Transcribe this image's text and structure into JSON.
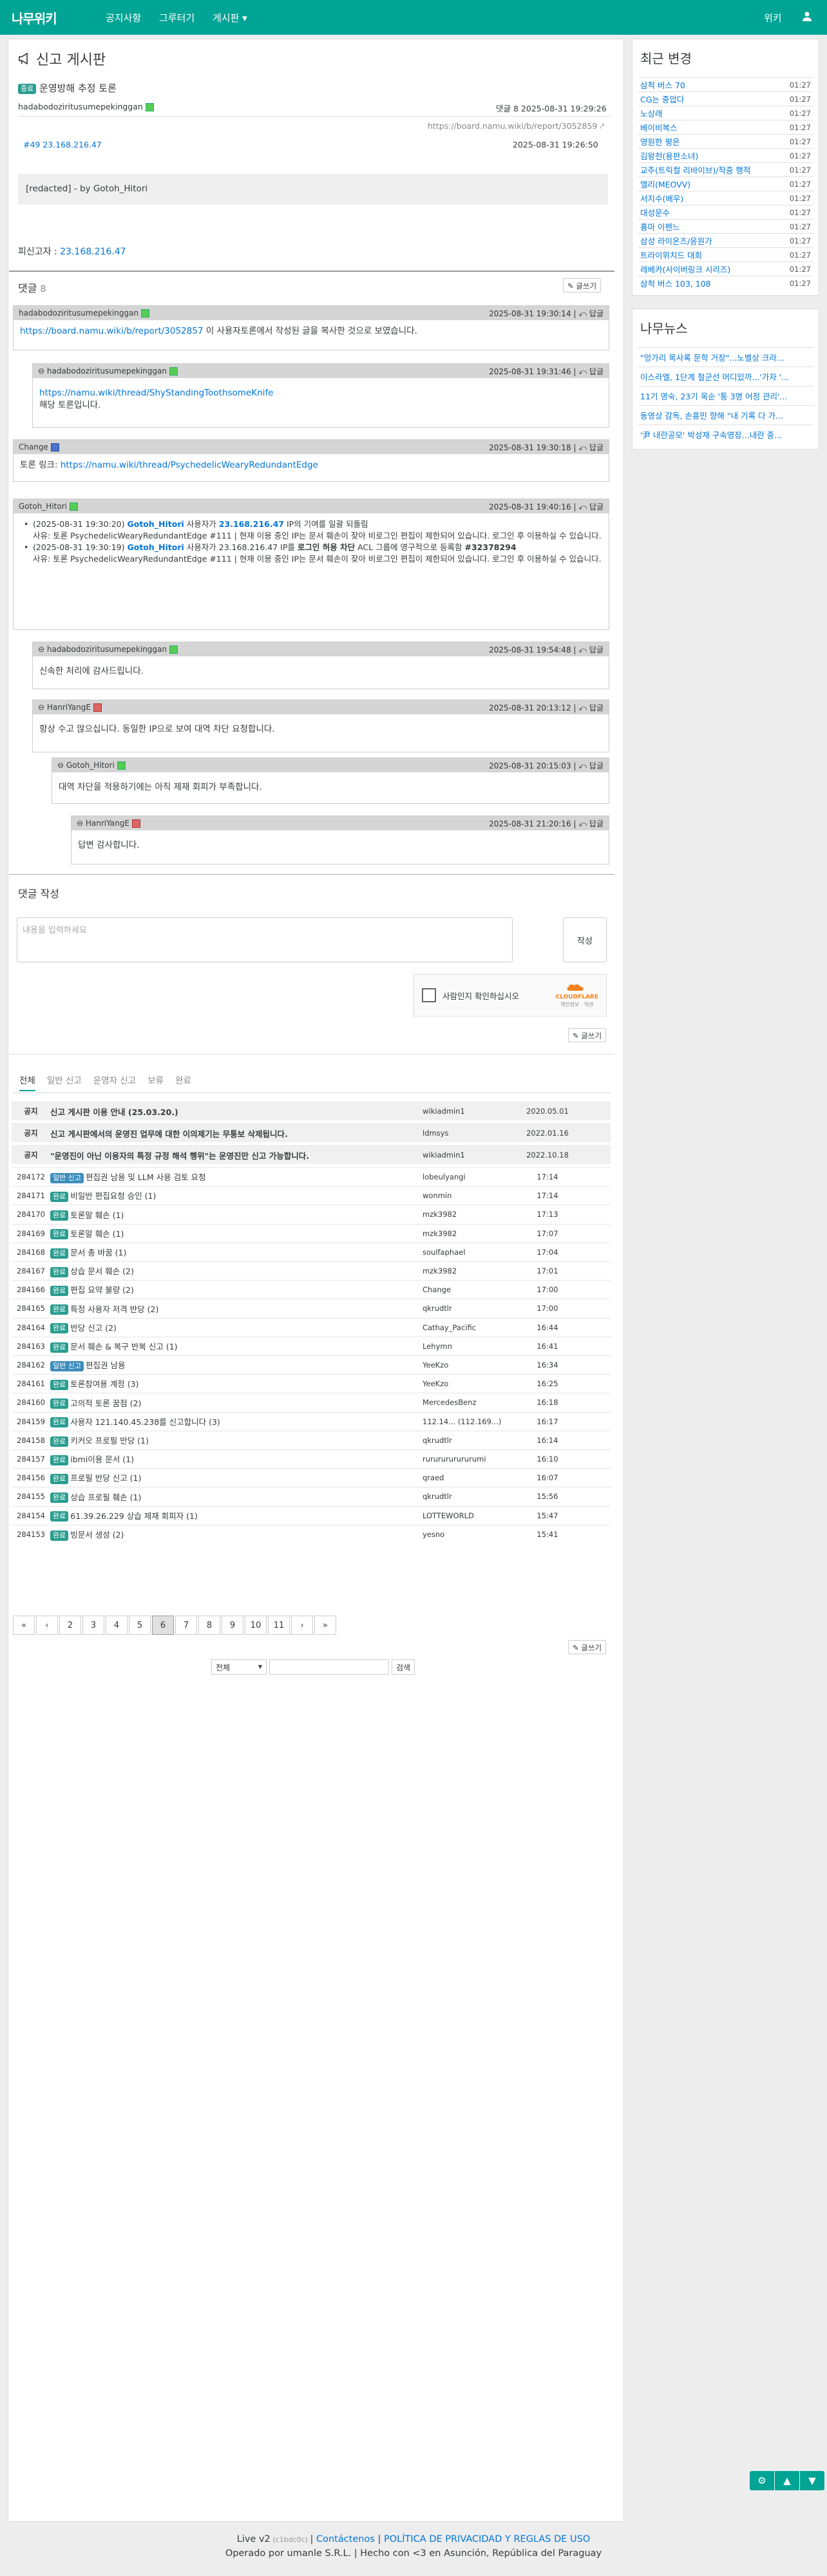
{
  "nav": {
    "logo": "나무위키",
    "items": [
      "공지사항",
      "그루터기",
      "게시판 ▾"
    ],
    "wiki": "위키",
    "user_icon": "user-icon"
  },
  "post": {
    "title": "신고 게시판",
    "badge": "종료",
    "subject": "운영방해 추정 토론",
    "author": "hadabodoziritusumepekinggan",
    "reply_label": "댓글",
    "datetime": "8 2025-08-31 19:29:26",
    "url": "https://board.namu.wiki/b/report/3052859",
    "ref": "#49 23.168.216.47",
    "ref_time": "2025-08-31 19:26:50",
    "quote": "[redacted] - by Gotoh_Hitori",
    "last_editor_label": "피신고자 :",
    "last_editor": "23.168.216.47"
  },
  "comments": {
    "title": "댓글",
    "count": "8",
    "write_label": "글쓰기",
    "reply": "답글",
    "items": [
      {
        "author": "hadabodoziritusumepekinggan",
        "time": "2025-08-31 19:30:14",
        "link": "https://board.namu.wiki/b/report/3052857",
        "text": " 이 사용자토론에서 작성된 글을 복사한 것으로 보였습니다."
      },
      {
        "author": "hadabodoziritusumepekinggan",
        "time": "2025-08-31 19:31:46",
        "link": "https://namu.wiki/thread/ShyStandingToothsomeKnife",
        "text": "해당 토론입니다."
      },
      {
        "author": "Change",
        "time": "2025-08-31 19:30:18",
        "label": "토론 링크: ",
        "link": "https://namu.wiki/thread/PsychedelicWearyRedundantEdge"
      },
      {
        "author": "Gotoh_Hitori",
        "time": "2025-08-31 19:40:16",
        "l1a": "(2025-08-31 19:30:20) ",
        "l1b": "Gotoh_Hitori",
        "l1c": " 사용자가 ",
        "l1d": "23.168.216.47",
        "l1e": " IP의 기여를 일괄 되돌림",
        "l1f": "사유: 토론 PsychedelicWearyRedundantEdge #111 | 현재 이용 중인 IP는 문서 훼손이 잦아 비로그인 편집이 제한되어 있습니다. 로그인 후 이용하실 수 있습니다.",
        "l2a": "(2025-08-31 19:30:19) ",
        "l2b": "Gotoh_Hitori",
        "l2c": " 사용자가 23.168.216.47 IP를 ",
        "l2d": "로그인 허용 차단",
        "l2e": " ACL 그룹에 영구적으로 등록함 ",
        "l2f": "#32378294",
        "l2g": "사유: 토론 PsychedelicWearyRedundantEdge #111 | 현재 이용 중인 IP는 문서 훼손이 잦아 비로그인 편집이 제한되어 있습니다. 로그인 후 이용하실 수 있습니다."
      },
      {
        "author": "hadabodoziritusumepekinggan",
        "time": "2025-08-31 19:54:48",
        "text": "신속한 처리에 감사드립니다."
      },
      {
        "author": "HanriYangE",
        "time": "2025-08-31 20:13:12",
        "text": "항상 수고 많으십니다. 동일한 IP으로 보여 대역 차단 요청합니다."
      },
      {
        "author": "Gotoh_Hitori",
        "time": "2025-08-31 20:15:03",
        "text": "대역 차단을 적용하기에는 아직 제재 회피가 부족합니다."
      },
      {
        "author": "HanriYangE",
        "time": "2025-08-31 21:20:16",
        "text": "답변 감사합니다."
      }
    ]
  },
  "form": {
    "title": "댓글 작성",
    "placeholder": "내용을 입력하세요",
    "submit": "작성",
    "captcha": "사람인지 확인하십시오",
    "cf": "CLOUDFLARE",
    "cf_sub": "개인정보 · 약관",
    "write": "글쓰기"
  },
  "list": {
    "tabs": [
      "전체",
      "일반 신고",
      "운영자 신고",
      "보류",
      "완료"
    ],
    "notices": [
      {
        "no": "공지",
        "title": "신고 게시판 이용 안내 (25.03.20.)",
        "author": "wikiadmin1",
        "date": "2020.05.01"
      },
      {
        "no": "공지",
        "title": "신고 게시판에서의 운영진 업무에 대한 이의제기는 무통보 삭제됩니다.",
        "author": "ldmsys",
        "date": "2022.01.16"
      },
      {
        "no": "공지",
        "title": "\"운영진이 아닌 이용자의 특정 규정 해석 행위\"는 운영진만 신고 가능합니다.",
        "author": "wikiadmin1",
        "date": "2022.10.18"
      }
    ],
    "rows": [
      {
        "no": "284172",
        "badge": "일반 신고",
        "title": "편집권 남용 및 LLM 사용 검토 요청",
        "author": "lobeulyangi",
        "date": "17:14"
      },
      {
        "no": "284171",
        "badge": "완료",
        "title": "비일반 편집요청 승인 (1)",
        "author": "wonmin",
        "date": "17:14"
      },
      {
        "no": "284170",
        "badge": "완료",
        "title": "토론말 훼손 (1)",
        "author": "mzk3982",
        "date": "17:13"
      },
      {
        "no": "284169",
        "badge": "완료",
        "title": "토론말 훼손 (1)",
        "author": "mzk3982",
        "date": "17:07"
      },
      {
        "no": "284168",
        "badge": "완료",
        "title": "문서 총 바꿈 (1)",
        "author": "soulfaphael",
        "date": "17:04"
      },
      {
        "no": "284167",
        "badge": "완료",
        "title": "상습 문서 훼손 (2)",
        "author": "mzk3982",
        "date": "17:01"
      },
      {
        "no": "284166",
        "badge": "완료",
        "title": "편집 요약 불량 (2)",
        "author": "Change",
        "date": "17:00"
      },
      {
        "no": "284165",
        "badge": "완료",
        "title": "특정 사용자 저격 반당 (2)",
        "author": "qkrudtlr",
        "date": "17:00"
      },
      {
        "no": "284164",
        "badge": "완료",
        "title": "반당 신고 (2)",
        "author": "Cathay_Pacific",
        "date": "16:44"
      },
      {
        "no": "284163",
        "badge": "완료",
        "title": "문서 훼손 & 복구 반복 신고 (1)",
        "author": "Lehymn",
        "date": "16:41"
      },
      {
        "no": "284162",
        "badge": "일반 신고",
        "title": "편집권 남용",
        "author": "YeeKzo",
        "date": "16:34"
      },
      {
        "no": "284161",
        "badge": "완료",
        "title": "토론참여용 계정 (3)",
        "author": "YeeKzo",
        "date": "16:25"
      },
      {
        "no": "284160",
        "badge": "완료",
        "title": "고의적 토론 꿈점 (2)",
        "author": "MercedesBenz",
        "date": "16:18"
      },
      {
        "no": "284159",
        "badge": "완료",
        "title": "사용자 121.140.45.238를 신고합니다 (3)",
        "author": "112.14... (112.169...)",
        "date": "16:17"
      },
      {
        "no": "284158",
        "badge": "완료",
        "title": "키커오 프로필 반당 (1)",
        "author": "qkrudtlr",
        "date": "16:14"
      },
      {
        "no": "284157",
        "badge": "완료",
        "title": "ibmi이용 문서 (1)",
        "author": "rururururururumi",
        "date": "16:10"
      },
      {
        "no": "284156",
        "badge": "완료",
        "title": "프로필 반당 신고 (1)",
        "author": "qraed",
        "date": "16:07"
      },
      {
        "no": "284155",
        "badge": "완료",
        "title": "상습 프로필 훼손 (1)",
        "author": "qkrudtlr",
        "date": "15:56"
      },
      {
        "no": "284154",
        "badge": "완료",
        "title": "61.39.26.229 상습 제재 회피자 (1)",
        "author": "LOTTEWORLD",
        "date": "15:47"
      },
      {
        "no": "284153",
        "badge": "완료",
        "title": "빙문서 생성 (2)",
        "author": "yesno",
        "date": "15:41"
      }
    ],
    "pages": [
      "«",
      "‹",
      "2",
      "3",
      "4",
      "5",
      "6",
      "7",
      "8",
      "9",
      "10",
      "11",
      "›",
      "»"
    ],
    "current_page": "6",
    "search_select": "전체",
    "search_btn": "검색",
    "write": "글쓰기"
  },
  "sidebar": {
    "recent_title": "최근 변경",
    "recent": [
      {
        "t": "삼척 버스 70",
        "d": "01:27"
      },
      {
        "t": "CG는 중압다",
        "d": "01:27"
      },
      {
        "t": "노상래",
        "d": "01:27"
      },
      {
        "t": "베이비복스",
        "d": "01:27"
      },
      {
        "t": "영원한 평온",
        "d": "01:27"
      },
      {
        "t": "김왕천(용판소녀)",
        "d": "01:27"
      },
      {
        "t": "교주(트릭컬 리바이브)/작중 행적",
        "d": "01:27"
      },
      {
        "t": "엘리(MEOVV)",
        "d": "01:27"
      },
      {
        "t": "서지수(배우)",
        "d": "01:27"
      },
      {
        "t": "대성운수",
        "d": "01:27"
      },
      {
        "t": "흉마 이펜느",
        "d": "01:27"
      },
      {
        "t": "삼성 라이온즈/응원가",
        "d": "01:27"
      },
      {
        "t": "트라이위치드 대회",
        "d": "01:27"
      },
      {
        "t": "레베카(사이버링크 시리즈)",
        "d": "01:27"
      },
      {
        "t": "삼척 버스 103, 108",
        "d": "01:27"
      }
    ],
    "news_title": "나무뉴스",
    "news": [
      "\"엉가리 목사록 문학 거장\"...노벨상 크라...",
      "이스라엘, 1단계 철군선 머디있까...'가자 '...",
      "11기 영숙, 23기 옥순 '통 3명 어정 관리'...",
      "동영상 감독, 손흥민 향해 \"내 기록 다 가...",
      "'尹 내란공모' 박성재 구속영장...내란 중..."
    ]
  },
  "footer": {
    "line1a": "Live v2",
    "line1b": " (c1bdc0c) ",
    "line1c": "Contáctenos",
    "line1d": "POLÍTICA DE PRIVACIDAD Y REGLAS DE USO",
    "line2": "Operado por umanle S.R.L. | Hecho con <3 en Asunción, República del Paraguay"
  },
  "colors": {
    "brand": "#00a495",
    "link": "#0275d8"
  }
}
